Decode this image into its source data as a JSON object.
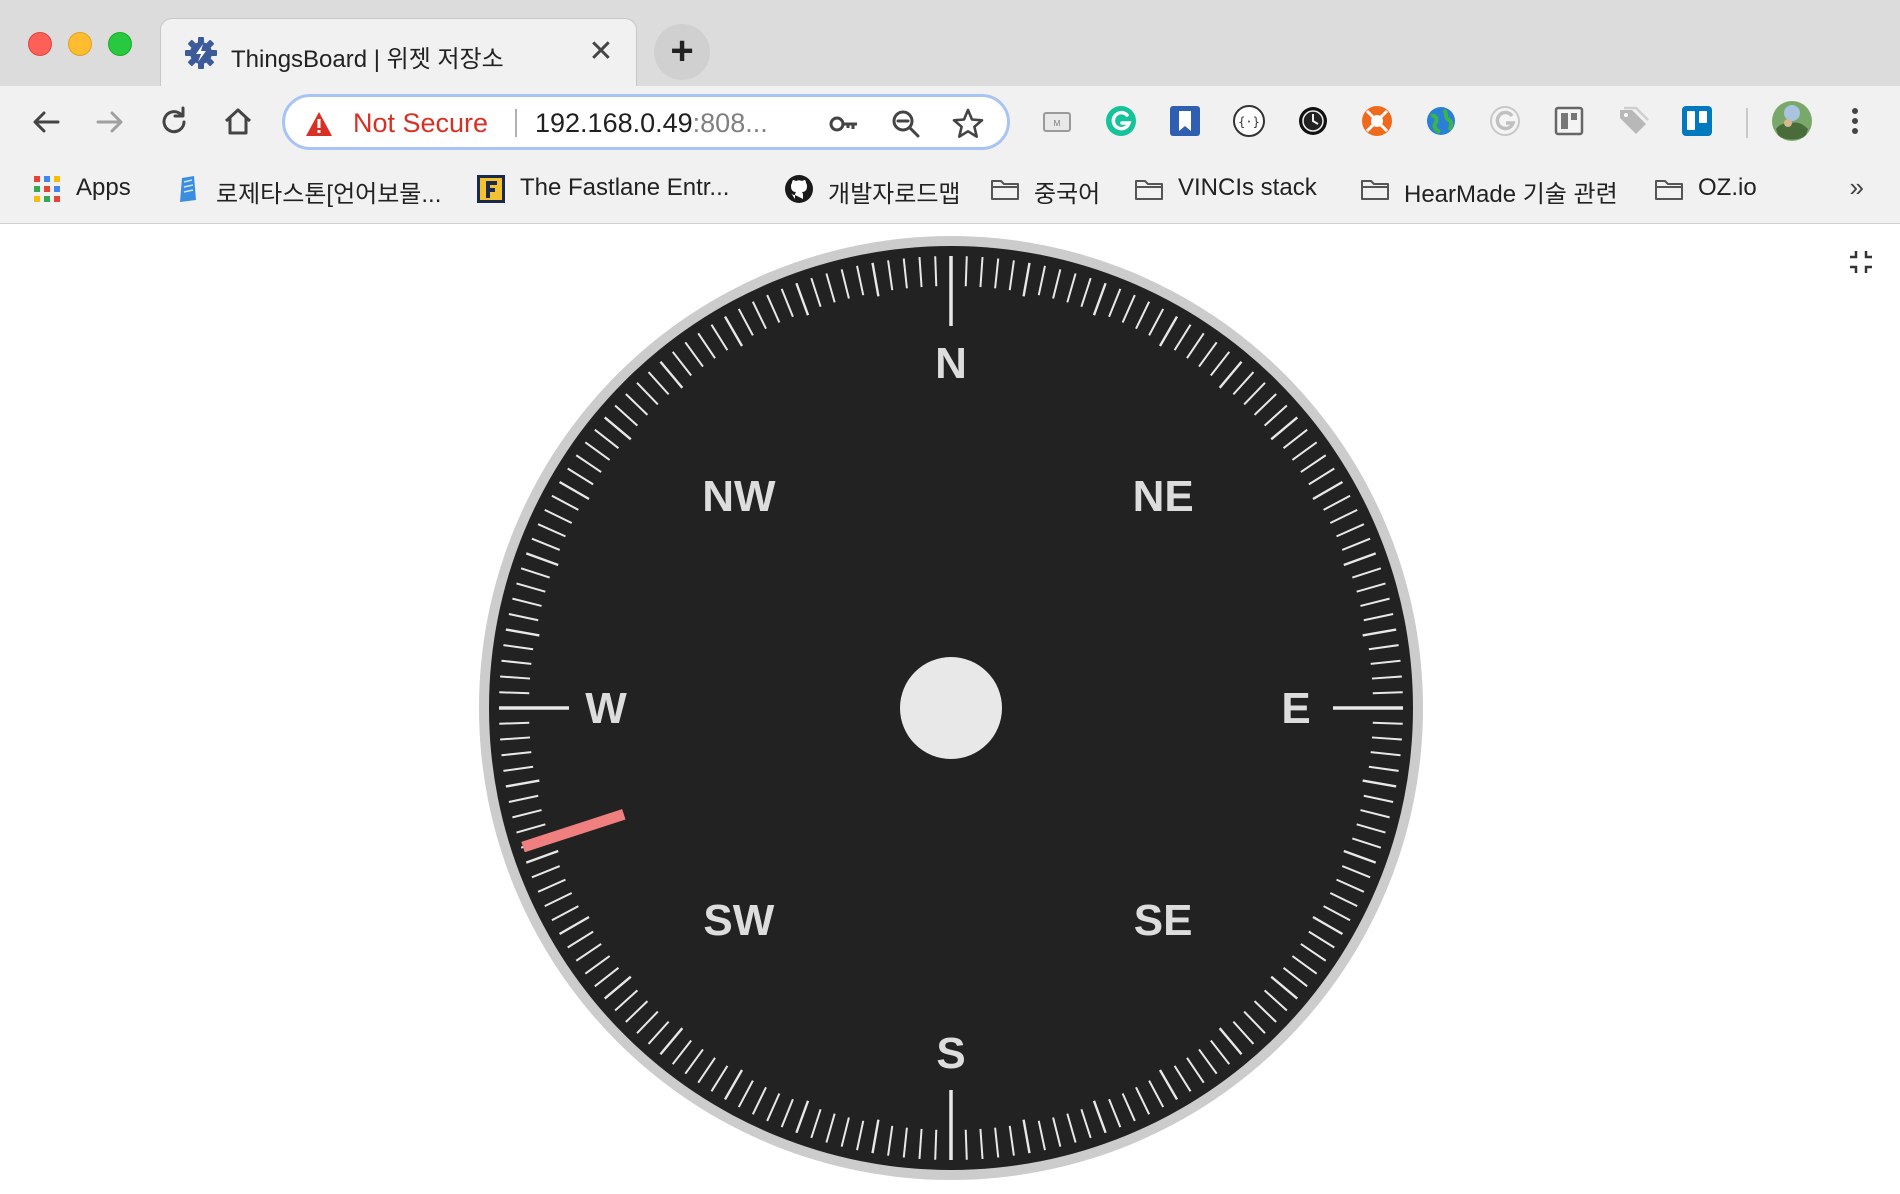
{
  "browser": {
    "tab": {
      "title": "ThingsBoard | 위젯 저장소",
      "favicon": "thingsboard-gear-icon",
      "close_glyph": "✕"
    },
    "new_tab_glyph": "+",
    "address_bar": {
      "security_label": "Not Secure",
      "url_host": "192.168.0.49",
      "url_rest": ":808..."
    },
    "bookmarks": [
      {
        "label": "Apps",
        "icon": "apps-grid-icon"
      },
      {
        "label": "로제타스톤[언어보물...",
        "icon": "rosetta-stone-icon"
      },
      {
        "label": "The Fastlane Entr...",
        "icon": "fastlane-icon"
      },
      {
        "label": "개발자로드맵",
        "icon": "github-icon"
      },
      {
        "label": "중국어",
        "icon": "folder-icon"
      },
      {
        "label": "VINCIs stack",
        "icon": "folder-icon"
      },
      {
        "label": "HearMade 기술 관련",
        "icon": "folder-icon"
      },
      {
        "label": "OZ.io",
        "icon": "folder-icon"
      }
    ],
    "bookmarks_overflow": "»"
  },
  "compass": {
    "cardinal_labels": [
      "N",
      "NE",
      "E",
      "SE",
      "S",
      "SW",
      "W",
      "NW"
    ],
    "needle_heading_deg": 252,
    "colors": {
      "dial": "#222222",
      "rim": "#cccccc",
      "ticks": "#e8e8e8",
      "labels": "#dddddd",
      "needle": "#f08080",
      "hub": "#e8e8e8"
    }
  }
}
